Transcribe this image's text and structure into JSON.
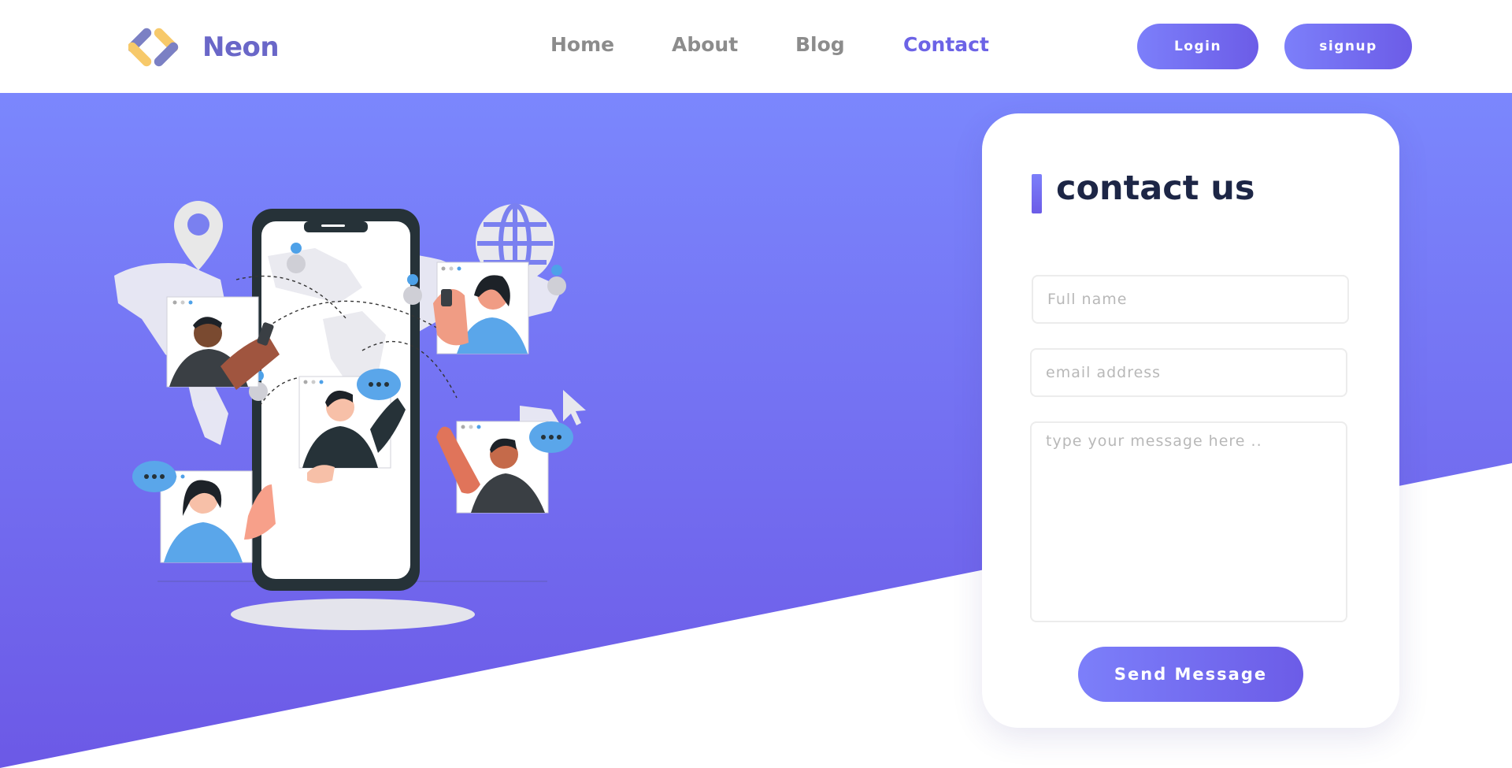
{
  "brand": {
    "name": "Neon"
  },
  "nav": {
    "items": [
      {
        "label": "Home",
        "active": false
      },
      {
        "label": "About",
        "active": false
      },
      {
        "label": "Blog",
        "active": false
      },
      {
        "label": "Contact",
        "active": true
      }
    ]
  },
  "auth": {
    "login_label": "Login",
    "signup_label": "signup"
  },
  "contact": {
    "title": "contact us",
    "fullname_placeholder": "Full name",
    "email_placeholder": "email address",
    "message_placeholder": "type your message here ..",
    "send_label": "Send Message"
  },
  "colors": {
    "accent": "#6c5ce7",
    "accent_light": "#7c7ffa",
    "title": "#1d2646",
    "nav_inactive": "#8c8c8c"
  },
  "icons": {
    "logo": "neon-chevron-logo",
    "illustration": "global-communication-phone-illustration"
  }
}
